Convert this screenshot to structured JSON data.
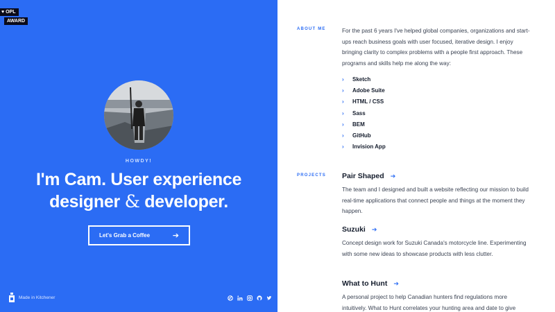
{
  "badge": {
    "line1": "♥ OPL",
    "line2": "AWARD"
  },
  "hero": {
    "howdy": "HOWDY!",
    "headline_line1": "I'm Cam. User experience",
    "headline_line2_a": "designer",
    "headline_amp": "&",
    "headline_line2_b": "developer.",
    "cta_label": "Let's Grab a Coffee",
    "cta_arrow": "➔"
  },
  "footer": {
    "made_in": "Made in Kitchener",
    "socials": [
      "dribbble-icon",
      "linkedin-icon",
      "instagram-icon",
      "github-icon",
      "twitter-icon"
    ]
  },
  "about": {
    "label": "ABOUT ME",
    "text": "For the past 6 years I've helped global companies, organizations and start-ups reach business goals with user focused, iterative design. I enjoy bringing clarity to complex problems with a people first approach. These programs and skills help me along the way:",
    "skills": [
      "Sketch",
      "Adobe Suite",
      "HTML / CSS",
      "Sass",
      "BEM",
      "GitHub",
      "Invision App"
    ]
  },
  "projects": {
    "label": "PROJECTS",
    "items": [
      {
        "title": "Pair Shaped",
        "desc": "The team and I designed and built a website reflecting our mission to build real-time applications that connect people and things at the moment they happen."
      },
      {
        "title": "Suzuki",
        "desc": "Concept design work for Suzuki Canada's motorcycle line. Experimenting with some new ideas to showcase products with less clutter."
      },
      {
        "title": "What to Hunt",
        "desc": "A personal project to help Canadian hunters find regulations more intuitively. What to Hunt correlates your hunting area and date to give"
      }
    ]
  },
  "colors": {
    "accent": "#2b6cf4",
    "text_dark": "#141c2c",
    "text_body": "#3a4252"
  }
}
